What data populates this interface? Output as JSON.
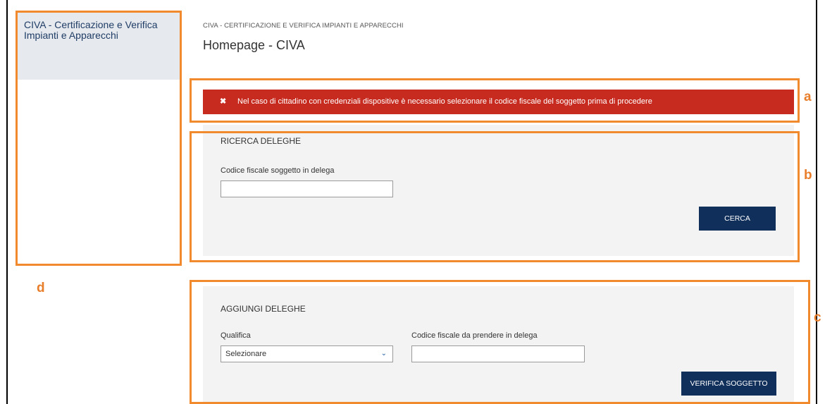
{
  "sidebar": {
    "title": "CIVA - Certificazione e Verifica Impianti e Apparecchi"
  },
  "header": {
    "breadcrumb": "CIVA - CERTIFICAZIONE E VERIFICA IMPIANTI E APPARECCHI",
    "title": "Homepage - CIVA"
  },
  "alert": {
    "icon": "close-icon",
    "icon_glyph": "✖",
    "message": "Nel caso di cittadino con credenziali dispositive è necessario selezionare il codice fiscale del soggetto prima di procedere",
    "color": "#c72b1f"
  },
  "ricerca": {
    "title": "RICERCA DELEGHE",
    "field_label": "Codice fiscale soggetto in delega",
    "field_value": "",
    "button_label": "CERCA"
  },
  "aggiungi": {
    "title": "AGGIUNGI DELEGHE",
    "qualifica_label": "Qualifica",
    "qualifica_value": "Selezionare",
    "codice_label": "Codice fiscale da prendere in delega",
    "codice_value": "",
    "button_label": "VERIFICA SOGGETTO"
  },
  "annotations": {
    "a": "a",
    "b": "b",
    "c": "c",
    "d": "d",
    "color": "#f08a2c"
  },
  "theme": {
    "primary_button": "#102f5b",
    "panel_bg": "#f3f3f3",
    "sidebar_bg": "#e6e9ee"
  }
}
